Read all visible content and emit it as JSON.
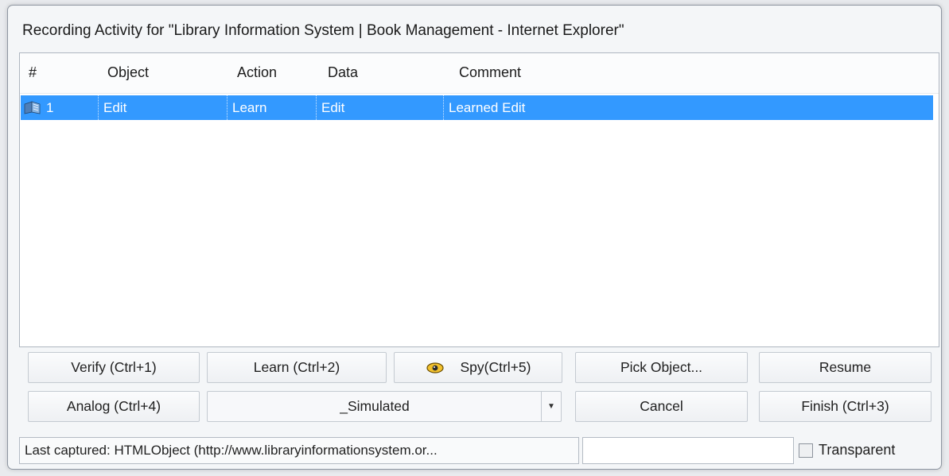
{
  "window": {
    "title": "Recording Activity for \"Library Information System | Book Management - Internet Explorer\""
  },
  "grid": {
    "columns": [
      "#",
      "Object",
      "Action",
      "Data",
      "Comment"
    ],
    "rows": [
      {
        "num": "1",
        "object": "Edit",
        "action": "Learn",
        "data": "Edit",
        "comment": "Learned Edit",
        "icon": "book-icon",
        "selected": true
      }
    ]
  },
  "buttons": {
    "verify": "Verify (Ctrl+1)",
    "learn": "Learn (Ctrl+2)",
    "spy": "Spy(Ctrl+5)",
    "pick_object": "Pick Object...",
    "resume": "Resume",
    "analog": "Analog (Ctrl+4)",
    "cancel": "Cancel",
    "finish": "Finish (Ctrl+3)"
  },
  "mode_select": {
    "value": "_Simulated"
  },
  "status": {
    "last_captured": "Last captured:  HTMLObject (http://www.libraryinformationsystem.or...",
    "secondary": ""
  },
  "transparent": {
    "label": "Transparent",
    "checked": false
  },
  "colors": {
    "selection": "#3399ff",
    "window_bg": "#f4f6f8"
  }
}
